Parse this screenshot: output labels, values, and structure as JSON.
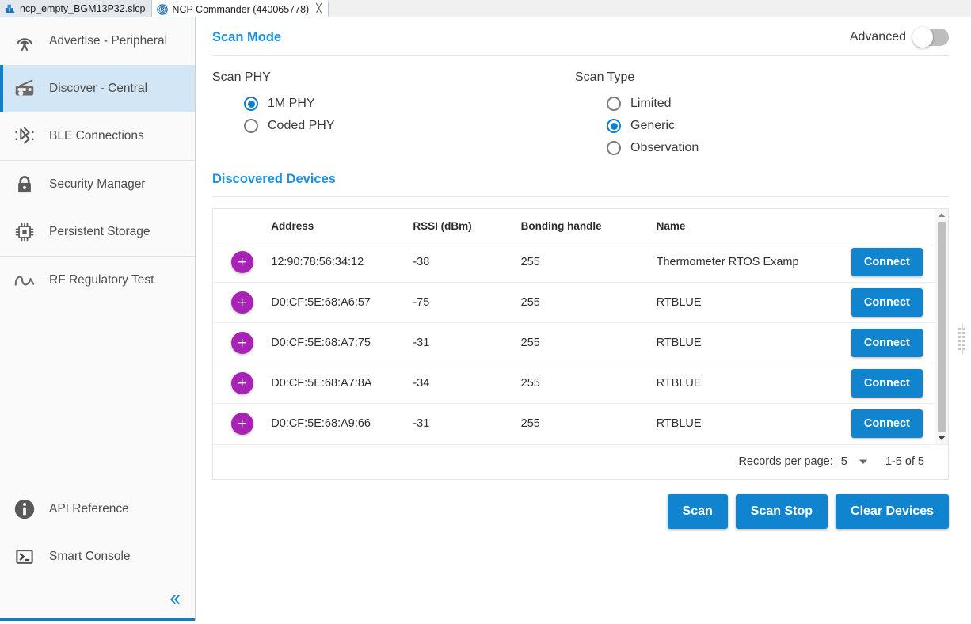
{
  "tabs": [
    {
      "label": "ncp_empty_BGM13P32.slcp",
      "icon": "slcp-file-icon",
      "active": false,
      "closable": false
    },
    {
      "label": "NCP Commander (440065778)",
      "icon": "bluetooth-circle-icon",
      "active": true,
      "closable": true,
      "close_glyph": "╳"
    }
  ],
  "sidebar": {
    "items": [
      {
        "label": "Advertise - Peripheral",
        "icon": "broadcast-antenna-icon",
        "selected": false
      },
      {
        "label": "Discover - Central",
        "icon": "radio-receiver-icon",
        "selected": true
      },
      {
        "label": "BLE Connections",
        "icon": "bluetooth-connections-icon",
        "selected": false
      },
      {
        "label": "Security Manager",
        "icon": "lock-icon",
        "selected": false
      },
      {
        "label": "Persistent Storage",
        "icon": "chip-icon",
        "selected": false
      },
      {
        "label": "RF Regulatory Test",
        "icon": "sine-wave-icon",
        "selected": false
      }
    ],
    "bottom_items": [
      {
        "label": "API Reference",
        "icon": "info-circle-icon"
      },
      {
        "label": "Smart Console",
        "icon": "terminal-icon"
      }
    ],
    "collapse_icon": "chevron-double-left-icon",
    "accent_color": "#0c80c8",
    "selected_bg": "#d3e6f5"
  },
  "main": {
    "scan_mode": {
      "title": "Scan Mode",
      "advanced_label": "Advanced",
      "advanced_enabled": false
    },
    "scan_phy": {
      "title": "Scan PHY",
      "options": [
        {
          "label": "1M PHY",
          "selected": true
        },
        {
          "label": "Coded PHY",
          "selected": false
        }
      ]
    },
    "scan_type": {
      "title": "Scan Type",
      "options": [
        {
          "label": "Limited",
          "selected": false
        },
        {
          "label": "Generic",
          "selected": true
        },
        {
          "label": "Observation",
          "selected": false
        }
      ]
    },
    "discovered": {
      "title": "Discovered Devices",
      "columns": [
        "",
        "Address",
        "RSSI (dBm)",
        "Bonding handle",
        "Name",
        ""
      ],
      "rows": [
        {
          "add_icon": "plus-circle-icon",
          "address": "12:90:78:56:34:12",
          "rssi": "-38",
          "bonding_handle": "255",
          "name": "Thermometer RTOS Examp",
          "action": "Connect"
        },
        {
          "add_icon": "plus-circle-icon",
          "address": "D0:CF:5E:68:A6:57",
          "rssi": "-75",
          "bonding_handle": "255",
          "name": "RTBLUE",
          "action": "Connect"
        },
        {
          "add_icon": "plus-circle-icon",
          "address": "D0:CF:5E:68:A7:75",
          "rssi": "-31",
          "bonding_handle": "255",
          "name": "RTBLUE",
          "action": "Connect"
        },
        {
          "add_icon": "plus-circle-icon",
          "address": "D0:CF:5E:68:A7:8A",
          "rssi": "-34",
          "bonding_handle": "255",
          "name": "RTBLUE",
          "action": "Connect"
        },
        {
          "add_icon": "plus-circle-icon",
          "address": "D0:CF:5E:68:A9:66",
          "rssi": "-31",
          "bonding_handle": "255",
          "name": "RTBLUE",
          "action": "Connect"
        }
      ],
      "pager": {
        "records_per_page_label": "Records per page:",
        "records_per_page_value": "5",
        "range": "1-5 of 5"
      }
    },
    "actions": {
      "scan": "Scan",
      "scan_stop": "Scan Stop",
      "clear_devices": "Clear Devices"
    },
    "accent_blue": "#1e90e0",
    "button_blue": "#1184d0",
    "add_purple": "#a822b5"
  }
}
